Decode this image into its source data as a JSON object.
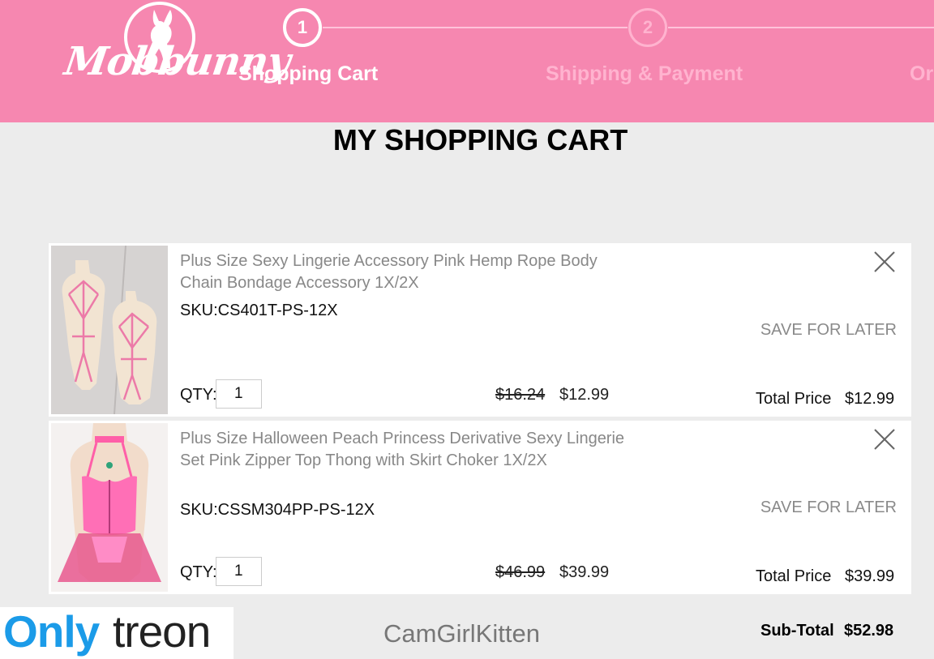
{
  "brand": {
    "logo_text": "Mobbunny"
  },
  "steps": [
    {
      "number": "1",
      "label": "Shopping Cart"
    },
    {
      "number": "2",
      "label": "Shipping & Payment"
    },
    {
      "label": "Or"
    }
  ],
  "page_title": "MY SHOPPING CART",
  "items": [
    {
      "name": "Plus Size Sexy Lingerie Accessory Pink Hemp Rope Body Chain Bondage Accessory 1X/2X",
      "sku": "SKU:CS401T-PS-12X",
      "save_for_later": "SAVE FOR LATER",
      "qty_label": "QTY:",
      "qty": "1",
      "old_price": "$16.24",
      "price": "$12.99",
      "total_label": "Total Price",
      "total": "$12.99"
    },
    {
      "name": "Plus Size Halloween Peach Princess Derivative Sexy Lingerie Set Pink Zipper Top Thong with Skirt Choker 1X/2X",
      "sku": "SKU:CSSM304PP-PS-12X",
      "save_for_later": "SAVE FOR LATER",
      "qty_label": "QTY:",
      "qty": "1",
      "old_price": "$46.99",
      "price": "$39.99",
      "total_label": "Total Price",
      "total": "$39.99"
    }
  ],
  "subtotal": {
    "label": "Sub-Total",
    "value": "$52.98"
  },
  "watermark": {
    "part1": "Only",
    "part2": "treon",
    "username": "CamGirlKitten"
  },
  "colors": {
    "header_pink": "#f687b0",
    "page_bg": "#ececec",
    "watermark_blue": "#1b9be8"
  }
}
